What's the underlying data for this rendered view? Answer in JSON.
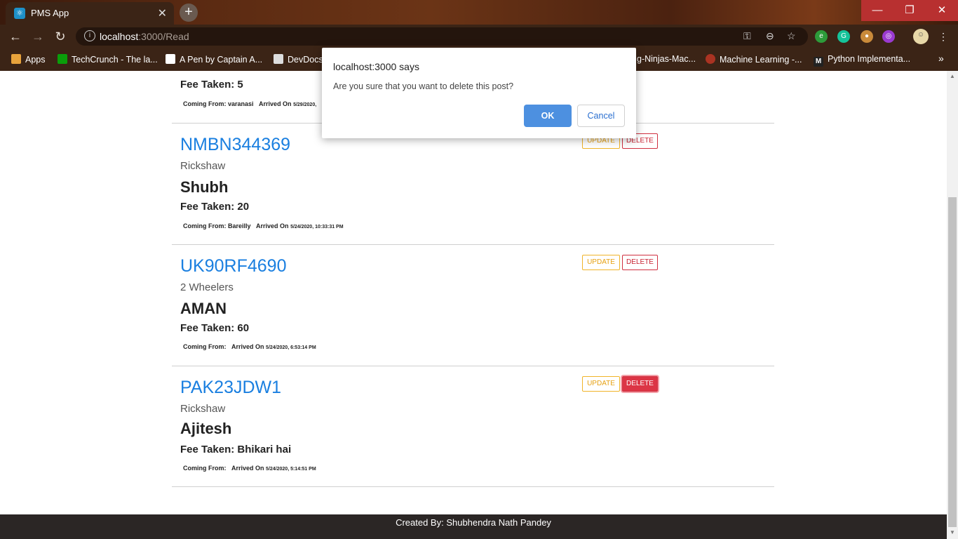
{
  "browser": {
    "tab_title": "PMS App",
    "url_host": "localhost",
    "url_rest": ":3000/Read",
    "bookmarks": [
      {
        "label": "Apps",
        "icon_color": "#e8a33c"
      },
      {
        "label": "TechCrunch - The la...",
        "icon_color": "#0a9e0a"
      },
      {
        "label": "A Pen by Captain A...",
        "icon_color": "#ffffff"
      },
      {
        "label": "DevDocs",
        "icon_color": "#dddddd"
      },
      {
        "label": "g-Ninjas-Mac...",
        "icon_color": "#cc6622"
      },
      {
        "label": "Machine Learning -...",
        "icon_color": "#aa3322"
      },
      {
        "label": "Python Implementa...",
        "icon_color": "#222222"
      }
    ],
    "more_bookmarks": "»"
  },
  "records": [
    {
      "plate": "",
      "type": "",
      "name": "",
      "fee": "Fee Taken: 5",
      "coming_from": "Coming From: varanasi",
      "arrived": "Arrived On",
      "arrived_time": "5/29/2020,"
    },
    {
      "plate": "NMBN344369",
      "type": "Rickshaw",
      "name": "Shubh",
      "fee": "Fee Taken: 20",
      "coming_from": "Coming From: Bareilly",
      "arrived": "Arrived On",
      "arrived_time": "5/24/2020, 10:33:31 PM",
      "update_label": "UPDATE",
      "delete_label": "DELETE"
    },
    {
      "plate": "UK90RF4690",
      "type": "2 Wheelers",
      "name": "AMAN",
      "fee": "Fee Taken: 60",
      "coming_from": "Coming From:",
      "arrived": "Arrived On",
      "arrived_time": "5/24/2020, 6:53:14 PM",
      "update_label": "UPDATE",
      "delete_label": "DELETE"
    },
    {
      "plate": "PAK23JDW1",
      "type": "Rickshaw",
      "name": "Ajitesh",
      "fee": "Fee Taken: Bhikari hai",
      "coming_from": "Coming From:",
      "arrived": "Arrived On",
      "arrived_time": "5/24/2020, 5:14:51 PM",
      "update_label": "UPDATE",
      "delete_label": "DELETE"
    }
  ],
  "footer": "Created By: Shubhendra Nath Pandey",
  "dialog": {
    "title": "localhost:3000 says",
    "message": "Are you sure that you want to delete this post?",
    "ok": "OK",
    "cancel": "Cancel"
  },
  "colors": {
    "plate": "#1a7fe0",
    "update": "#f0b429",
    "delete": "#dc3545",
    "footer_bg": "#2b2625",
    "dialog_ok": "#4d90e0"
  }
}
